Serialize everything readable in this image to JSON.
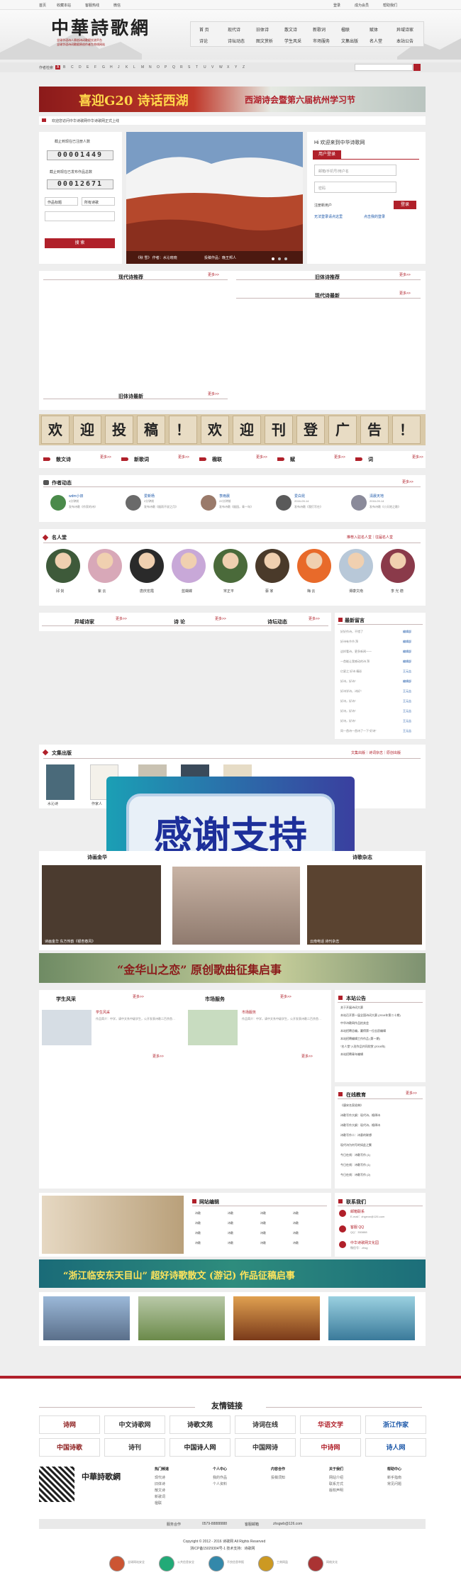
{
  "topbar": {
    "items": [
      "首页",
      "收藏本站",
      "客服热线",
      "微信"
    ],
    "right": [
      "登录",
      "成为会员",
      "帮助我们"
    ]
  },
  "header": {
    "logo": "中華詩歌網",
    "slogan1": "全球华语诗人原创诗词歌赋交流平台",
    "slogan2": "全球华语诗词歌赋原创作者生命线网站"
  },
  "nav": {
    "row1": [
      "首 页",
      "现代诗",
      "旧体诗",
      "散文诗",
      "新歌词",
      "楹联",
      "赋体",
      "异域诗家"
    ],
    "row2": [
      "诗论",
      "诗坛动态",
      "图文赏析",
      "学生风采",
      "市场服务",
      "文集出版",
      "名人堂",
      "本站公告"
    ]
  },
  "alpha": {
    "label": "作者检索",
    "letters": [
      "A",
      "B",
      "C",
      "D",
      "E",
      "F",
      "G",
      "H",
      "J",
      "K",
      "L",
      "M",
      "N",
      "O",
      "P",
      "Q",
      "R",
      "S",
      "T",
      "U",
      "V",
      "W",
      "X",
      "Y",
      "Z"
    ]
  },
  "banner1": {
    "left": "喜迎G20 诗话西湖",
    "right": "西湖诗会暨第六届杭州学习节"
  },
  "notice": "欢迎您访问中华诗歌网中华诗歌网正式上线",
  "stats": {
    "label1": "截止到现在已注册人数",
    "count1": "00001449",
    "label2": "截止到现在已发布作品总数",
    "count2": "00012671",
    "select1": "作品标题",
    "select2": "所有诗歌",
    "search": "搜 索"
  },
  "slide": {
    "caption": "《秋 雪》 作者：水沁晓晓",
    "caption2": "投稿作品：晚王邦人"
  },
  "login": {
    "title": "Hi 欢迎来到中华诗歌网",
    "tab": "用户登录",
    "ph_user": "邮箱/手机号/用户名",
    "ph_pass": "密码",
    "register": "注册新用户",
    "login": "登录",
    "remember": "无法登录请点这里",
    "forgot": "点击我的登录"
  },
  "sec": {
    "modern": "现代诗推荐",
    "old": "旧体诗推荐",
    "modern_new": "现代诗最新",
    "old_new": "旧体诗最新",
    "more": "更多>>"
  },
  "poster": [
    "欢",
    "迎",
    "投",
    "稿",
    "！",
    "欢",
    "迎",
    "刊",
    "登",
    "广",
    "告",
    "！"
  ],
  "cats": [
    "散文诗",
    "新歌词",
    "楹联",
    "赋",
    "词"
  ],
  "authors": {
    "title": "作者动态",
    "items": [
      {
        "name": "wdm小旧",
        "date": "4分钟前",
        "text": "发布诗歌《作家的诗》"
      },
      {
        "name": "爱新杨",
        "date": "2分钟前",
        "text": "发布诗歌《烟雨不说之月》"
      },
      {
        "name": "李雨晨",
        "date": "22分钟前",
        "text": "发布诗歌《烟园，青一年》"
      },
      {
        "name": "爱白昆",
        "date": "2016-09-14",
        "text": "发布诗歌《我们写在》"
      },
      {
        "name": "清晨天地",
        "date": "2016-09-14",
        "text": "发布诗歌《小天地之歌》"
      }
    ]
  },
  "famous": {
    "title": "名人堂",
    "links": "推荐入驻名人堂｜往届名人堂",
    "names": [
      "邱 剑",
      "紫 云",
      "唐庆宏霞",
      "蓝蝴蝶",
      "宋正平",
      "蔡 家",
      "梅 云",
      "谭康文南",
      "李 光 德"
    ]
  },
  "tri": [
    "异域诗家",
    "诗 论",
    "诗坛动态"
  ],
  "latest": {
    "title": "最新留言",
    "items": [
      {
        "t": "好好作诗，不错了",
        "n": "编辑部"
      },
      {
        "t": "好诗有节节 拜",
        "n": "编辑部"
      },
      {
        "t": "这样看诗，更多新闻一一",
        "n": "编辑部"
      },
      {
        "t": "一首能让我感动的诗 拜",
        "n": "编辑部"
      },
      {
        "t": "亿星之 好诗 精彩",
        "n": "王元吉"
      },
      {
        "t": "好诗，好诗！",
        "n": "编辑部"
      },
      {
        "t": "好诗学诗，诗好！",
        "n": "王元吉"
      },
      {
        "t": "好诗，好诗！",
        "n": "王元吉"
      },
      {
        "t": "好诗，好诗！",
        "n": "王元吉"
      },
      {
        "t": "好诗，好诗！",
        "n": "王元吉"
      },
      {
        "t": "同一首诗一首诗了一下“好诗”",
        "n": "王元吉"
      }
    ]
  },
  "wenji": {
    "title": "文集出版",
    "links": "文集出版｜诗词杂志｜原创出版",
    "books": [
      {
        "t": "水沁诗",
        "n": "罗西"
      },
      {
        "t": "作家人",
        "n": "林若"
      }
    ]
  },
  "overlay": "感谢支持",
  "huajuan": {
    "title": "诗画金华",
    "caption": "诗画金华 东方传韵《银杏春风》"
  },
  "zazhi": {
    "title": "诗歌杂志",
    "caption": "云南电话 诗刊杂志"
  },
  "banner2": "“金华山之恋” 原创歌曲征集启事",
  "student": {
    "title": "学生风采",
    "name": "学生风采",
    "text": "作品简介：中学，请中文系中级学生，公开发表诗歌二百余首…"
  },
  "market": {
    "title": "市场服务",
    "name": "市场服务",
    "text": "作品简介：中学，请中文系中级学生，公开发表诗歌二百余首…"
  },
  "announce": {
    "title": "本站公告",
    "items": [
      "关于开展诗词大赛",
      "本站召开第一届全国诗词大赛 (2016年第二十期)",
      "中华诗歌网作品拍卖会",
      "本站招聘总编，赢得第一位志愿编辑",
      "本站招聘编辑工作作品 (第一期)",
      "“名人堂”入驻作品共同欣赏 (2016年)",
      "本站招聘青年编辑"
    ]
  },
  "online": {
    "title": "在线教育",
    "items": [
      "《唐宋名家经典》",
      "诗歌写作大纲：现代诗，格律诗",
      "诗歌写作大纲：现代诗，格律诗",
      "诗歌写作二：诗意的联想",
      "现代诗为何写的如此之繁",
      "今日在线：诗歌写作 (1)",
      "今日在线：诗歌写作 (1)",
      "今日在线：诗歌写作 (2)"
    ]
  },
  "editors": {
    "title": "网站编辑",
    "items": [
      "诗歌",
      "诗歌",
      "诗歌",
      "诗歌",
      "诗歌",
      "诗歌",
      "诗歌",
      "诗歌",
      "诗歌",
      "诗歌",
      "诗歌",
      "诗歌",
      "诗歌",
      "诗歌",
      "诗歌",
      "诗歌"
    ]
  },
  "contact": {
    "title": "联系我们",
    "items": [
      {
        "t": "邮箱联系",
        "s": "E-mail：zhgexw@126.com"
      },
      {
        "t": "客服 QQ",
        "s": "QQ：350888"
      },
      {
        "t": "中华诗歌网文化园",
        "s": "微信号：zhsg"
      }
    ]
  },
  "banner3": "“浙江临安东天目山” 超好诗歌散文 (游记) 作品征稿启事",
  "friends": {
    "title": "友情链接",
    "logos": [
      "诗网",
      "中文诗歌网",
      "诗歌文苑",
      "诗词在线",
      "华语文学",
      "浙江作家",
      "中国诗歌",
      "诗刊",
      "中国诗人网",
      "中国网诗",
      "中诗网",
      "诗人网"
    ]
  },
  "footer": {
    "cols": [
      {
        "h": "热门频道",
        "i": [
          "现代诗",
          "旧体诗",
          "散文诗",
          "新歌词",
          "楹联"
        ]
      },
      {
        "h": "个人中心",
        "i": [
          "我的作品",
          "个人资料"
        ]
      },
      {
        "h": "内容合作",
        "i": [
          "投稿须知"
        ]
      },
      {
        "h": "关于我们",
        "i": [
          "网站介绍",
          "联系方式",
          "版权声明"
        ]
      },
      {
        "h": "帮助中心",
        "i": [
          "新手指南",
          "常见问题"
        ]
      }
    ],
    "bar": [
      "服务合作",
      "0579-88888888",
      "客服邮箱",
      "zhsgwb@126.com"
    ],
    "copy": "Copyright © 2012 - 2016 诗歌网 All Rights Reserved",
    "icp": "浙ICP备15029304号-1 技术支持：诗歌网",
    "badges": [
      "全球网站安全",
      "公共信息安全",
      "不良信息举报",
      "工商网监",
      "网络文化"
    ]
  },
  "colors": {
    "accent": "#b0202a"
  }
}
